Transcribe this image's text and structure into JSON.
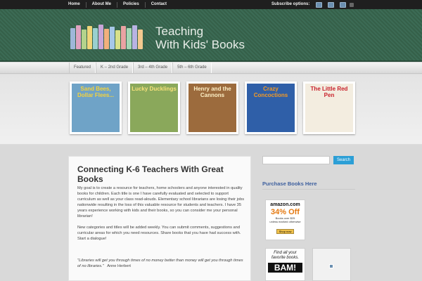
{
  "topnav": {
    "items": [
      {
        "label": "Home"
      },
      {
        "label": "About Me"
      },
      {
        "label": "Policies"
      },
      {
        "label": "Contact"
      }
    ],
    "subscribe_label": "Subscribe options:",
    "social_icons": [
      "facebook-icon",
      "twitter-icon",
      "linkedin-icon",
      "rss-icon"
    ]
  },
  "header": {
    "title_line1": "Teaching",
    "title_line2": "With Kids' Books",
    "bg_color": "#3c6b55"
  },
  "categories": [
    {
      "label": "Featured"
    },
    {
      "label": "K – 2nd Grade"
    },
    {
      "label": "3rd – 4th Grade"
    },
    {
      "label": "5th – 6th Grade"
    }
  ],
  "featured_books": [
    {
      "title": "Sand Bees, Dollar Flees...",
      "color": "#6fa3c7"
    },
    {
      "title": "Lucky Ducklings",
      "color": "#8aa85b"
    },
    {
      "title": "Henry and the Cannons",
      "color": "#9c6b3d"
    },
    {
      "title": "Crazy Concoctions",
      "color": "#2f5fa8"
    },
    {
      "title": "The Little Red Pen",
      "color": "#f3ede0"
    }
  ],
  "post": {
    "title": "Connecting K-6 Teachers With Great Books",
    "paragraph1": "My goal is to create a resource for teachers, home schoolers and anyone interested in quality books for children. Each title is one I have carefully evaluated and selected to support curriculum as well as your class read-alouds. Elementary school librarians are losing their jobs nationwide resulting in the loss of this valuable resource for students and teachers. I have 35 years experience working with kids and their books, so you can consider me your personal librarian!",
    "paragraph2": "New categories and titles will be added weekly. You can submit comments, suggestions and curricular areas for which you need resources. Share books that you have had success with.",
    "paragraph3": "Start a dialogue!",
    "quote": "\"Libraries will get you through times of no money better than money will get you through times of no libraries.\"",
    "quote_author": "Anne Herbert"
  },
  "sidebar": {
    "search_placeholder": "",
    "search_button": "Search",
    "purchase_title": "Purchase Books Here",
    "title_color": "#3d5f9e",
    "amazon_ad": {
      "brand": "amazon.com",
      "percent": "34% Off",
      "line1": "Books over $25",
      "line2": "unless marked otherwise",
      "shop": "Shop now"
    },
    "bam_ad": {
      "find": "Find all your favorite books.",
      "logo": "BAM!"
    }
  }
}
